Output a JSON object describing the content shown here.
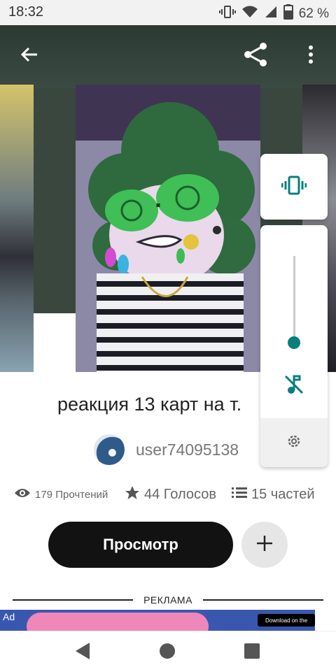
{
  "status_bar": {
    "time": "18:32",
    "battery": "62 %"
  },
  "story": {
    "title": "реакция 13 карт на т.",
    "author": "user74095138",
    "reads": "179 Прочтений",
    "votes": "44 Голосов",
    "parts": "15 частей"
  },
  "actions": {
    "read_label": "Просмотр"
  },
  "ad": {
    "divider_label": "РЕКЛАМА",
    "tag": "Ad",
    "store_badge": "Download on the"
  },
  "volume_panel": {
    "level": 0.1,
    "accent_color": "#097f7c"
  },
  "icons": {
    "back": "arrow-left-icon",
    "share": "share-icon",
    "more": "more-vert-icon",
    "vibrate": "vibrate-icon",
    "mute": "music-off-icon",
    "settings": "gear-icon",
    "reads": "eye-icon",
    "votes": "star-icon",
    "parts": "list-icon",
    "add": "plus-icon"
  }
}
